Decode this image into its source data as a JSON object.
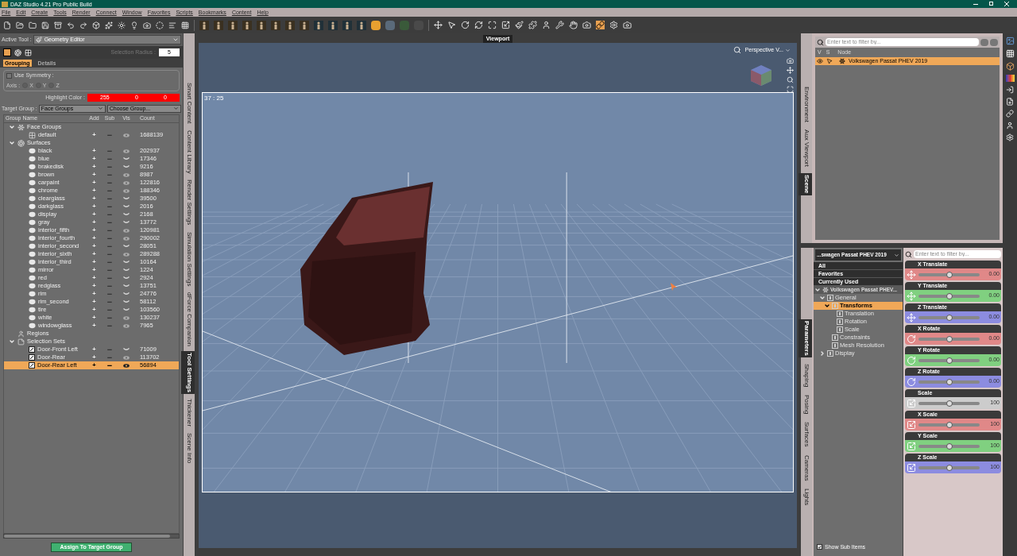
{
  "window": {
    "title": "DAZ Studio 4.21 Pro Public Build"
  },
  "menu": [
    "File",
    "Edit",
    "Create",
    "Tools",
    "Render",
    "Connect",
    "Window",
    "Favorites",
    "Scripts",
    "Bookmarks",
    "Content",
    "Help"
  ],
  "active_tool": {
    "label": "Active Tool :",
    "value": "Geometry Editor"
  },
  "selection_radius": {
    "label": "Selection Radius :",
    "value": "5"
  },
  "tool_tabs": [
    {
      "label": "Grouping",
      "selected": true
    },
    {
      "label": "Details",
      "selected": false
    }
  ],
  "symmetry": {
    "label": "Use Symmetry :",
    "checked": false,
    "axis_label": "Axis :",
    "disabled": true,
    "axes": [
      {
        "label": "X",
        "selected": false
      },
      {
        "label": "Y",
        "selected": false
      },
      {
        "label": "Z",
        "selected": false
      }
    ]
  },
  "highlight_color": {
    "label": "Highlight Color :",
    "values": [
      "255",
      "0",
      "0"
    ],
    "color": "#ff0000"
  },
  "target_group": {
    "label": "Target Group :",
    "value": "Face Groups",
    "group": "Choose Group..."
  },
  "group_table": {
    "columns": [
      "Group Name",
      "Add",
      "Sub",
      "Vis",
      "Count"
    ],
    "rows": [
      {
        "name": "Face Groups",
        "kind": "face_groups",
        "expanded": true,
        "children": [
          {
            "name": "default",
            "kind": "face_group",
            "add": "+",
            "sub": "−",
            "visible": true,
            "count": "1688139",
            "selected": false
          }
        ]
      },
      {
        "name": "Surfaces",
        "kind": "surfaces",
        "expanded": true,
        "children": [
          {
            "name": "black",
            "kind": "surface",
            "add": "+",
            "sub": "−",
            "visible": true,
            "count": "202937",
            "selected": false
          },
          {
            "name": "blue",
            "kind": "surface",
            "add": "+",
            "sub": "−",
            "visible": false,
            "count": "17346",
            "selected": false
          },
          {
            "name": "brakedisk",
            "kind": "surface",
            "add": "+",
            "sub": "−",
            "visible": false,
            "count": "9216",
            "selected": false
          },
          {
            "name": "brown",
            "kind": "surface",
            "add": "+",
            "sub": "−",
            "visible": true,
            "count": "8987",
            "selected": false
          },
          {
            "name": "carpaint",
            "kind": "surface",
            "add": "+",
            "sub": "−",
            "visible": true,
            "count": "122816",
            "selected": false
          },
          {
            "name": "chrome",
            "kind": "surface",
            "add": "+",
            "sub": "−",
            "visible": true,
            "count": "188346",
            "selected": false
          },
          {
            "name": "clearglass",
            "kind": "surface",
            "add": "+",
            "sub": "−",
            "visible": false,
            "count": "39500",
            "selected": false
          },
          {
            "name": "darkglass",
            "kind": "surface",
            "add": "+",
            "sub": "−",
            "visible": false,
            "count": "2016",
            "selected": false
          },
          {
            "name": "display",
            "kind": "surface",
            "add": "+",
            "sub": "−",
            "visible": false,
            "count": "2168",
            "selected": false
          },
          {
            "name": "gray",
            "kind": "surface",
            "add": "+",
            "sub": "−",
            "visible": false,
            "count": "13772",
            "selected": false
          },
          {
            "name": "interior_fifth",
            "kind": "surface",
            "add": "+",
            "sub": "−",
            "visible": true,
            "count": "120981",
            "selected": false
          },
          {
            "name": "interior_fourth",
            "kind": "surface",
            "add": "+",
            "sub": "−",
            "visible": true,
            "count": "290002",
            "selected": false
          },
          {
            "name": "interior_second",
            "kind": "surface",
            "add": "+",
            "sub": "−",
            "visible": false,
            "count": "28051",
            "selected": false
          },
          {
            "name": "interior_sixth",
            "kind": "surface",
            "add": "+",
            "sub": "−",
            "visible": true,
            "count": "289288",
            "selected": false
          },
          {
            "name": "interior_third",
            "kind": "surface",
            "add": "+",
            "sub": "−",
            "visible": false,
            "count": "10164",
            "selected": false
          },
          {
            "name": "mirror",
            "kind": "surface",
            "add": "+",
            "sub": "−",
            "visible": false,
            "count": "1224",
            "selected": false
          },
          {
            "name": "red",
            "kind": "surface",
            "add": "+",
            "sub": "−",
            "visible": false,
            "count": "2924",
            "selected": false
          },
          {
            "name": "redglass",
            "kind": "surface",
            "add": "+",
            "sub": "−",
            "visible": false,
            "count": "13751",
            "selected": false
          },
          {
            "name": "rim",
            "kind": "surface",
            "add": "+",
            "sub": "−",
            "visible": false,
            "count": "24776",
            "selected": false
          },
          {
            "name": "rim_second",
            "kind": "surface",
            "add": "+",
            "sub": "−",
            "visible": false,
            "count": "58112",
            "selected": false
          },
          {
            "name": "tire",
            "kind": "surface",
            "add": "+",
            "sub": "−",
            "visible": false,
            "count": "103560",
            "selected": false
          },
          {
            "name": "white",
            "kind": "surface",
            "add": "+",
            "sub": "−",
            "visible": true,
            "count": "130237",
            "selected": false
          },
          {
            "name": "windowglass",
            "kind": "surface",
            "add": "+",
            "sub": "−",
            "visible": true,
            "count": "7965",
            "selected": false
          }
        ]
      },
      {
        "name": "Regions",
        "kind": "regions"
      },
      {
        "name": "Selection Sets",
        "kind": "selection_sets",
        "expanded": true,
        "children": [
          {
            "name": "Door-Front Left",
            "kind": "selection_set",
            "add": "+",
            "sub": "−",
            "visible": false,
            "count": "71009",
            "selected": false
          },
          {
            "name": "Door-Rear",
            "kind": "selection_set",
            "add": "+",
            "sub": "−",
            "visible": true,
            "count": "113702",
            "selected": false
          },
          {
            "name": "Door-Rear Left",
            "kind": "selection_set",
            "add": "+",
            "sub": "−",
            "visible": true,
            "count": "56894",
            "selected": true
          }
        ]
      }
    ]
  },
  "assign_button": "Assign To Target Group",
  "left_tabs": [
    {
      "label": "Smart Content",
      "selected": false
    },
    {
      "label": "Content Library",
      "selected": false
    },
    {
      "label": "Render Settings",
      "selected": false
    },
    {
      "label": "Simulation Settings",
      "selected": false
    },
    {
      "label": "dForce Companion",
      "selected": false
    },
    {
      "label": "Tool Settings",
      "selected": true
    },
    {
      "label": "Thickener",
      "selected": false
    },
    {
      "label": "Scene Info",
      "selected": false
    }
  ],
  "viewport": {
    "tab": "Viewport",
    "camera": "Perspective V...",
    "frame_label": "37 : 25"
  },
  "scene": {
    "tabs": [
      {
        "label": "Environment",
        "selected": false
      },
      {
        "label": "Aux Viewport",
        "selected": false
      },
      {
        "label": "Scene",
        "selected": true
      }
    ],
    "filter_placeholder": "Enter text to filter by...",
    "columns": [
      "V",
      "S",
      "Node"
    ],
    "nodes": [
      {
        "name": "Volkswagen Passat PHEV 2019",
        "visible": true,
        "selected": true
      }
    ]
  },
  "parameters": {
    "tabs": [
      {
        "label": "Parameters",
        "selected": true
      },
      {
        "label": "Shaping",
        "selected": false
      },
      {
        "label": "Posing",
        "selected": false
      },
      {
        "label": "Surfaces",
        "selected": false
      },
      {
        "label": "Cameras",
        "selected": false
      },
      {
        "label": "Lights",
        "selected": false
      }
    ],
    "node": "...swagen Passat PHEV 2019",
    "filter_placeholder": "Enter text to filter by...",
    "quick": [
      "All",
      "Favorites",
      "Currently Used"
    ],
    "tree": [
      {
        "label": "Volkswagen Passat PHEV...",
        "kind": "node",
        "expanded": true,
        "selected": false,
        "children": [
          {
            "label": "General",
            "kind": "group",
            "expanded": true,
            "selected": false,
            "children": [
              {
                "label": "Transforms",
                "kind": "group",
                "expanded": true,
                "selected": true,
                "children": [
                  {
                    "label": "Translation",
                    "kind": "group",
                    "selected": false
                  },
                  {
                    "label": "Rotation",
                    "kind": "group",
                    "selected": false
                  },
                  {
                    "label": "Scale",
                    "kind": "group",
                    "selected": false
                  }
                ]
              },
              {
                "label": "Constraints",
                "kind": "group",
                "selected": false
              },
              {
                "label": "Mesh Resolution",
                "kind": "group",
                "selected": false
              }
            ]
          },
          {
            "label": "Display",
            "kind": "group",
            "expanded": false,
            "selected": false
          }
        ]
      }
    ],
    "params": [
      {
        "name": "X Translate",
        "kind": "translate",
        "color": "#e08888",
        "value": "0.00",
        "level": 0.5
      },
      {
        "name": "Y Translate",
        "kind": "translate",
        "color": "#80d080",
        "value": "0.00",
        "level": 0.5
      },
      {
        "name": "Z Translate",
        "kind": "translate",
        "color": "#8c8ce0",
        "value": "0.00",
        "level": 0.5
      },
      {
        "name": "X Rotate",
        "kind": "rotate",
        "color": "#e08888",
        "value": "0.00",
        "level": 0.5
      },
      {
        "name": "Y Rotate",
        "kind": "rotate",
        "color": "#80d080",
        "value": "0.00",
        "level": 0.5
      },
      {
        "name": "Z Rotate",
        "kind": "rotate",
        "color": "#8c8ce0",
        "value": "0.00",
        "level": 0.5
      },
      {
        "name": "Scale",
        "kind": "scale",
        "color": "#cccccc",
        "value": "100",
        "level": 0.5
      },
      {
        "name": "X Scale",
        "kind": "scale",
        "color": "#e08888",
        "value": "100",
        "level": 0.5
      },
      {
        "name": "Y Scale",
        "kind": "scale",
        "color": "#80d080",
        "value": "100",
        "level": 0.5
      },
      {
        "name": "Z Scale",
        "kind": "scale",
        "color": "#8c8ce0",
        "value": "100",
        "level": 0.5
      }
    ],
    "show_sub_items": {
      "label": "Show Sub Items",
      "checked": true
    }
  }
}
